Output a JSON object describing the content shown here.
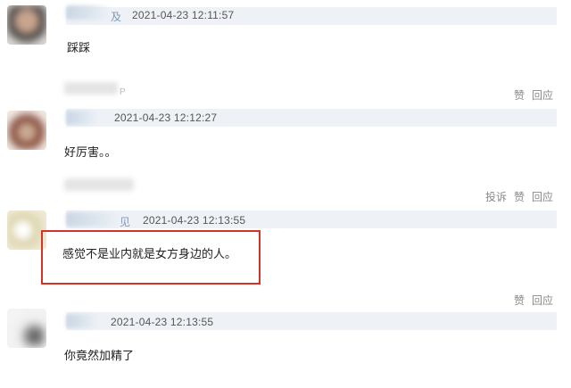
{
  "comments": [
    {
      "name_tail": "及",
      "timestamp": "2021-04-23 12:11:57",
      "text": "踩踩",
      "actions": []
    },
    {
      "name_tail": "P",
      "timestamp": "2021-04-23 12:12:27",
      "text": "好厉害。。",
      "actions": [
        "赞",
        "回应"
      ]
    },
    {
      "name_tail": "见",
      "timestamp": "2021-04-23 12:13:55",
      "text": "感觉不是业内就是女方身边的人。",
      "actions": [
        "投诉",
        "赞",
        "回应"
      ]
    },
    {
      "name_tail": "",
      "timestamp": "2021-04-23 12:13:55",
      "text": "你竟然加精了",
      "actions": [
        "赞",
        "回应"
      ]
    }
  ],
  "colors": {
    "highlight_border": "#d3332b",
    "header_bar": "#eef2f7",
    "action_text": "#888888"
  }
}
